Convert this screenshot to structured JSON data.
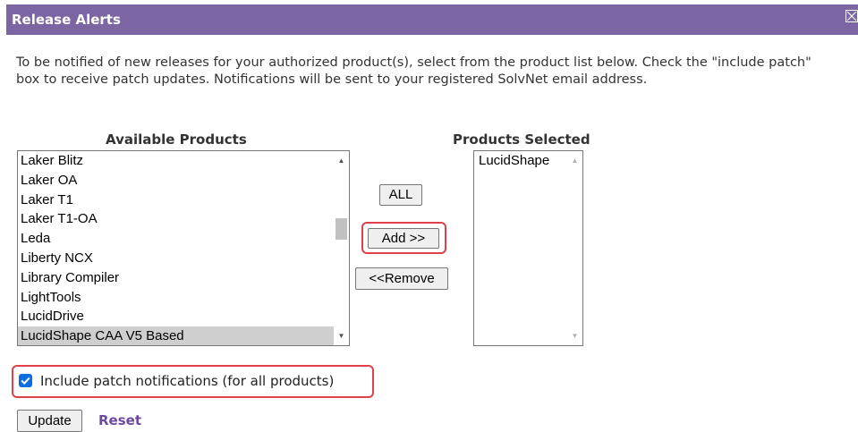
{
  "dialog": {
    "title": "Release Alerts",
    "intro": "To be notified of new releases for your authorized product(s), select from the product list below. Check the \"include patch\" box to receive patch updates. Notifications will be sent to your registered SolvNet email address."
  },
  "available": {
    "heading": "Available Products",
    "items": [
      "Laker Blitz",
      "Laker OA",
      "Laker T1",
      "Laker T1-OA",
      "Leda",
      "Liberty NCX",
      "Library Compiler",
      "LightTools",
      "LucidDrive",
      "LucidShape CAA V5 Based"
    ],
    "selected_index": 9
  },
  "selected": {
    "heading": "Products Selected",
    "items": [
      "LucidShape"
    ]
  },
  "buttons": {
    "all": "ALL",
    "add": "Add >>",
    "remove": "<<Remove",
    "update": "Update",
    "reset": "Reset"
  },
  "patch": {
    "label": "Include patch notifications (for all products)",
    "checked": true
  },
  "colors": {
    "titlebar": "#7b66a3",
    "highlight": "#e0404a",
    "checkbox": "#0b6ee0",
    "link": "#6b4aa0"
  }
}
